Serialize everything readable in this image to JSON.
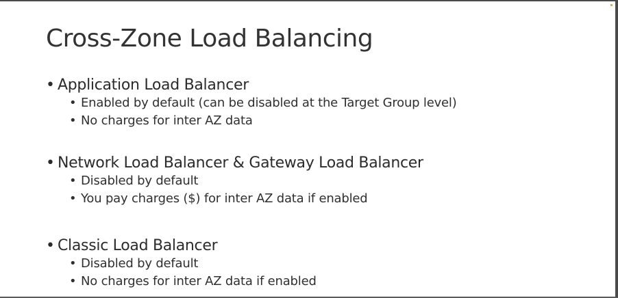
{
  "slide": {
    "title": "Cross-Zone Load Balancing",
    "sections": [
      {
        "heading": "Application Load Balancer",
        "items": [
          "Enabled by default (can be disabled at the Target Group level)",
          "No charges for inter AZ data"
        ]
      },
      {
        "heading": "Network Load Balancer & Gateway Load Balancer",
        "items": [
          "Disabled by default",
          "You pay charges ($) for inter AZ data if enabled"
        ]
      },
      {
        "heading": "Classic Load Balancer",
        "items": [
          "Disabled by default",
          "No charges for inter AZ data if enabled"
        ]
      }
    ]
  }
}
